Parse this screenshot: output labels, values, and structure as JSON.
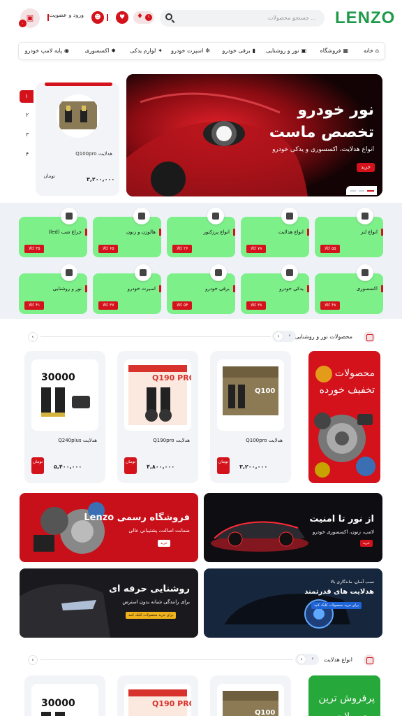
{
  "header": {
    "logo": "LENZO",
    "search_placeholder": "جستجو محصولات ...",
    "login_label": "ورود و عضویت",
    "notifications_count": "۱",
    "cart_count": "۰"
  },
  "nav": {
    "items": [
      {
        "label": "خانه",
        "icon": "home-icon"
      },
      {
        "label": "فروشگاه",
        "icon": "shop-icon"
      },
      {
        "label": "نور و روشنایی",
        "icon": "light-icon"
      },
      {
        "label": "برقی خودرو",
        "icon": "battery-icon"
      },
      {
        "label": "اسپرت خودرو",
        "icon": "wheel-icon"
      },
      {
        "label": "لوازم یدکی",
        "icon": "spare-icon"
      },
      {
        "label": "اکسسوری",
        "icon": "accessory-icon"
      },
      {
        "label": "پایه لامپ خودرو",
        "icon": "bulb-icon"
      }
    ]
  },
  "hero": {
    "title_line1": "نور خودرو",
    "title_line2": "تخصص ماست",
    "subtitle": "انواع هدلایت، اکسسوری و یدکی خودرو",
    "button": "خرید"
  },
  "side_product": {
    "name": "هدلایت Q100pro",
    "price": "۳,۲۰۰,۰۰۰",
    "currency": "تومان"
  },
  "pagination": [
    "۱",
    "۲",
    "۳",
    "۴"
  ],
  "categories": [
    {
      "label": "انواع لنز",
      "count": "۵۵ کالا"
    },
    {
      "label": "انواع هدلایت",
      "count": "۷۸ کالا"
    },
    {
      "label": "انواع پرژکتور",
      "count": "۲۶ کالا"
    },
    {
      "label": "هالوژن و زنون",
      "count": "۶۵ کالا"
    },
    {
      "label": "چراغ شب (led)",
      "count": "۳۵ کالا"
    },
    {
      "label": "اکسسوری",
      "count": "۴۸ کالا"
    },
    {
      "label": "یدکی خودرو",
      "count": "۳۸ کالا"
    },
    {
      "label": "برقی خودرو",
      "count": "۵۴ کالا"
    },
    {
      "label": "اسپرت خودرو",
      "count": "۳۷ کالا"
    },
    {
      "label": "نور و روشنایی",
      "count": "۴۱ کالا"
    }
  ],
  "section1": {
    "title": "محصولات نور و روشنایی",
    "promo_line1": "محصولات",
    "promo_line2": "تخفیف خورده",
    "products": [
      {
        "name": "هدلایت Q100pro",
        "price": "۳,۲۰۰,۰۰۰",
        "currency": "تومان",
        "box_text": "Q100"
      },
      {
        "name": "هدلایت Q190pro",
        "price": "۴,۸۰۰,۰۰۰",
        "currency": "تومان",
        "box_text": "Q190 PRO"
      },
      {
        "name": "هدلایت Q240plus",
        "price": "۵,۴۰۰,۰۰۰",
        "currency": "تومان",
        "box_text": "30000"
      }
    ]
  },
  "banners": {
    "b1_title": "از نور تا امنیت",
    "b1_sub": "لامپ، زنون، اکسسوری خودرو",
    "b1_btn": "خرید",
    "b2_title": "فروشگاه رسمی Lenzo",
    "b2_sub": "ضمانت اصالت، پشتیبانی عالی",
    "b2_btn": "خرید",
    "b3_pre": "نصب آسان، ماندگاری بالا",
    "b3_title": "هدلایت های قدرتمند",
    "b3_btn": "برای خرید محصولات کلیک کنید",
    "b4_title": "روشنایی حرفه ای",
    "b4_sub": "برای رانندگی شبانه بدون استرس",
    "b4_btn": "برای خرید محصولات کلیک کنید"
  },
  "section2": {
    "title": "انواع هدلایت",
    "promo_line1": "پرفروش ترین",
    "promo_line2": "محصولات",
    "products": [
      {
        "box_text": "Q100"
      },
      {
        "box_text": "Q190 PRO"
      },
      {
        "box_text": "30000"
      }
    ]
  },
  "colors": {
    "brand_red": "#d3121b",
    "category_green": "#7ef08a",
    "logo_green": "#1f9a4a"
  }
}
